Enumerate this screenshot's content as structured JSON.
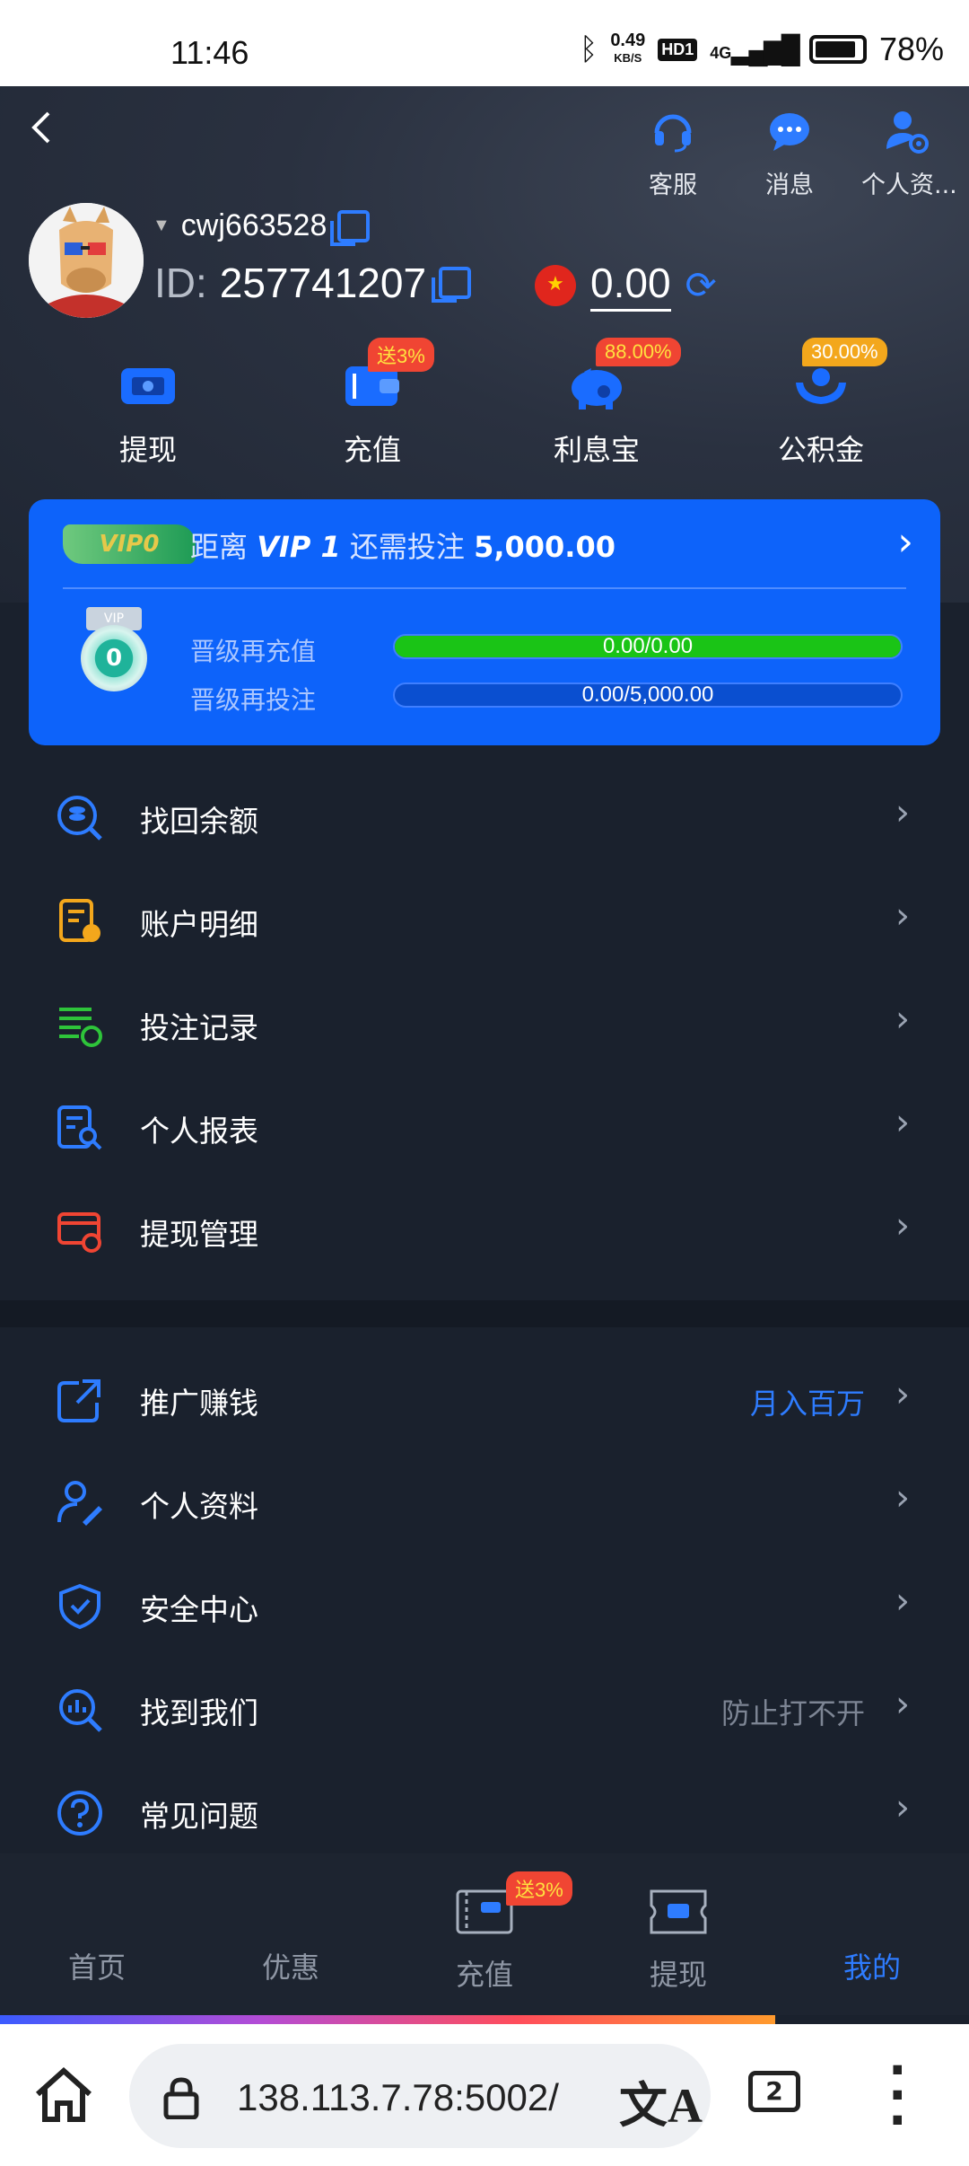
{
  "status_bar": {
    "time": "11:46",
    "speed": "0.49",
    "speed_unit": "KB/S",
    "hd": "HD1",
    "network": "4G",
    "battery": "78%"
  },
  "header": {
    "actions": [
      {
        "label": "客服",
        "icon": "headset-icon"
      },
      {
        "label": "消息",
        "icon": "chat-icon"
      },
      {
        "label": "个人资...",
        " icon": "user-settings-icon"
      }
    ],
    "username": "cwj663528",
    "id_label": "ID:",
    "id_value": "257741207",
    "balance": "0.00"
  },
  "quick_actions": [
    {
      "label": "提现",
      "badge": ""
    },
    {
      "label": "充值",
      "badge": "送3%"
    },
    {
      "label": "利息宝",
      "badge": "88.00%"
    },
    {
      "label": "公积金",
      "badge": "30.00%"
    }
  ],
  "vip": {
    "tag": "VIP0",
    "text_prefix": "距离",
    "next_level": "VIP 1",
    "text_mid": "还需投注",
    "amount": "5,000.00",
    "medal_level": "0",
    "medal_top": "VIP",
    "rows": [
      {
        "label": "晋级再充值",
        "value": "0.00/0.00",
        "fill": 1.0
      },
      {
        "label": "晋级再投注",
        "value": "0.00/5,000.00",
        "fill": 0.0
      }
    ]
  },
  "menu1": [
    {
      "label": "找回余额",
      "extra": ""
    },
    {
      "label": "账户明细",
      "extra": ""
    },
    {
      "label": "投注记录",
      "extra": ""
    },
    {
      "label": "个人报表",
      "extra": ""
    },
    {
      "label": "提现管理",
      "extra": ""
    }
  ],
  "menu2": [
    {
      "label": "推广赚钱",
      "extra": "月入百万"
    },
    {
      "label": "个人资料",
      "extra": ""
    },
    {
      "label": "安全中心",
      "extra": ""
    },
    {
      "label": "找到我们",
      "extra": "防止打不开"
    },
    {
      "label": "常见问题",
      "extra": ""
    }
  ],
  "bottom_nav": [
    {
      "label": "首页"
    },
    {
      "label": "优惠"
    },
    {
      "label": "充值",
      "badge": "送3%"
    },
    {
      "label": "提现"
    },
    {
      "label": "我的"
    }
  ],
  "browser": {
    "url": "138.113.7.78:5002/",
    "tab_count": "2"
  },
  "colors": {
    "accent": "#2e7cff",
    "vip_card": "#0d63fa",
    "background": "#1a212d",
    "badge_red": "#f04533",
    "badge_gold": "#f3a71c",
    "progress_green": "#1ac416"
  }
}
